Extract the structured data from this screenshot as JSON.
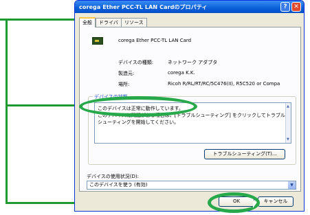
{
  "window": {
    "title": "corega Ether PCC-TL LAN Cardのプロパティ",
    "help_button": "?",
    "close_button": "✕"
  },
  "tabs": [
    {
      "label": "全般"
    },
    {
      "label": "ドライバ"
    },
    {
      "label": "リソース"
    }
  ],
  "device": {
    "name": "corega Ether PCC-TL LAN Card",
    "properties": [
      {
        "label": "デバイスの種類:",
        "value": "ネットワーク アダプタ"
      },
      {
        "label": "製造元:",
        "value": "corega K.K."
      },
      {
        "label": "場所:",
        "value": "Ricoh R/RL/RT/RC/5C476(II), R5C520 or Compa"
      }
    ]
  },
  "status": {
    "legend": "デバイスの状態",
    "line1": "このデバイスは正常に動作しています。",
    "line2": "このデバイスに問題がある場合は、[トラブルシューティング] をクリックしてトラブル",
    "line3": "シューティングを開始してください。",
    "troubleshoot_button": "トラブルシューティング(T)..."
  },
  "usage": {
    "label": "デバイスの使用状況(D):",
    "value": "このデバイスを使う (有効)"
  },
  "footer": {
    "ok_label": "OK",
    "cancel_label": "キャンセル"
  },
  "colors": {
    "callout": "#1f9a32",
    "titlebar": "#0a5fd6"
  }
}
